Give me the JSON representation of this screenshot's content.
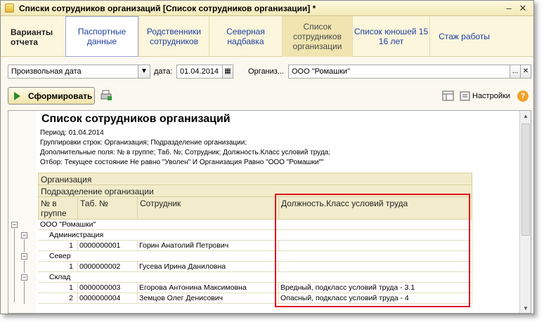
{
  "window": {
    "title": "Списки сотрудников организаций [Список сотрудников организации] *"
  },
  "tabs": {
    "first": "Варианты отчета",
    "items": [
      {
        "label": "Паспортные данные"
      },
      {
        "label": "Родственники сотрудников"
      },
      {
        "label": "Северная надбавка"
      },
      {
        "label": "Список сотрудников организации"
      },
      {
        "label": "Список юношей 15 16 лет"
      },
      {
        "label": "Стаж работы"
      }
    ]
  },
  "filters": {
    "period_type": "Произвольная дата",
    "date_label": "дата:",
    "date_value": "01.04.2014",
    "org_label": "Организ...",
    "org_value": "ООО \"Ромашки\""
  },
  "toolbar": {
    "generate_label": "Сформировать",
    "settings_label": "Настройки"
  },
  "report": {
    "title": "Список сотрудников организаций",
    "period": "Период: 01.04.2014",
    "grouping": "Группировки строк: Организация; Подразделение организации;",
    "extra_fields": "Дополнительные поля: № в группе; Таб. №; Сотрудник; Должность.Класс условий труда;",
    "selection": "Отбор: Текущее состояние Не равно \"Уволен\" И Организация Равно \"ООО \"Ромашки\"\"",
    "headers": {
      "organization": "Организация",
      "department": "Подразделение организации",
      "num": "№ в группе",
      "tab": "Таб. №",
      "employee": "Сотрудник",
      "position": "Должность.Класс условий труда"
    },
    "org_row": "ООО \"Ромашки\"",
    "groups": [
      {
        "name": "Администрация",
        "rows": [
          {
            "num": "1",
            "tab": "0000000001",
            "employee": "Горин Анатолий Петрович",
            "position": ""
          }
        ]
      },
      {
        "name": "Север",
        "rows": [
          {
            "num": "1",
            "tab": "0000000002",
            "employee": "Гусева Ирина Даниловна",
            "position": ""
          }
        ]
      },
      {
        "name": "Склад",
        "rows": [
          {
            "num": "1",
            "tab": "0000000003",
            "employee": "Егорова Антонина Максимовна",
            "position": "Вредный, подкласс условий труда - 3.1"
          },
          {
            "num": "2",
            "tab": "0000000004",
            "employee": "Земцов Олег Денисович",
            "position": "Опасный, подкласс условий труда - 4"
          }
        ]
      }
    ]
  }
}
